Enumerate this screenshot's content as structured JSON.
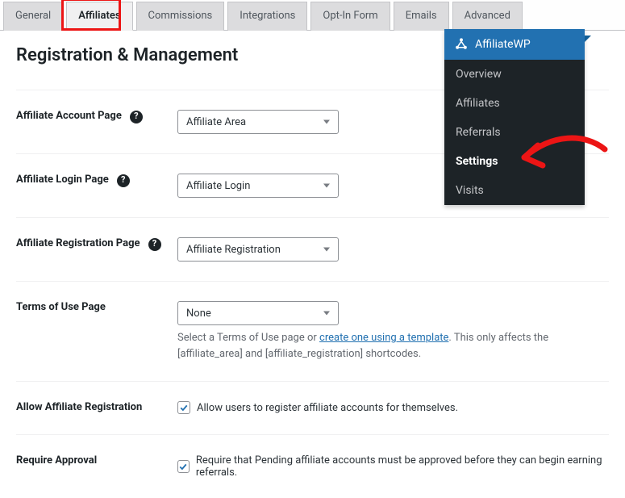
{
  "tabs": {
    "items": [
      {
        "label": "General"
      },
      {
        "label": "Affiliates"
      },
      {
        "label": "Commissions"
      },
      {
        "label": "Integrations"
      },
      {
        "label": "Opt-In Form"
      },
      {
        "label": "Emails"
      },
      {
        "label": "Advanced"
      }
    ],
    "active_index": 1
  },
  "section": {
    "title": "Registration & Management"
  },
  "fields": {
    "account_page": {
      "label": "Affiliate Account Page",
      "value": "Affiliate Area"
    },
    "login_page": {
      "label": "Affiliate Login Page",
      "value": "Affiliate Login"
    },
    "registration_page": {
      "label": "Affiliate Registration Page",
      "value": "Affiliate Registration"
    },
    "terms_page": {
      "label": "Terms of Use Page",
      "value": "None",
      "desc_pre": "Select a Terms of Use page or ",
      "desc_link": "create one using a template",
      "desc_post": ". This only affects the [affiliate_area] and [affiliate_registration] shortcodes."
    },
    "allow_registration": {
      "label": "Allow Affiliate Registration",
      "checkbox_label": "Allow users to register affiliate accounts for themselves.",
      "checked": true
    },
    "require_approval": {
      "label": "Require Approval",
      "checkbox_label": "Require that Pending affiliate accounts must be approved before they can begin earning referrals.",
      "checked": true
    }
  },
  "floatmenu": {
    "title": "AffiliateWP",
    "items": [
      {
        "label": "Overview"
      },
      {
        "label": "Affiliates"
      },
      {
        "label": "Referrals"
      },
      {
        "label": "Settings"
      },
      {
        "label": "Visits"
      }
    ],
    "active_index": 3
  }
}
